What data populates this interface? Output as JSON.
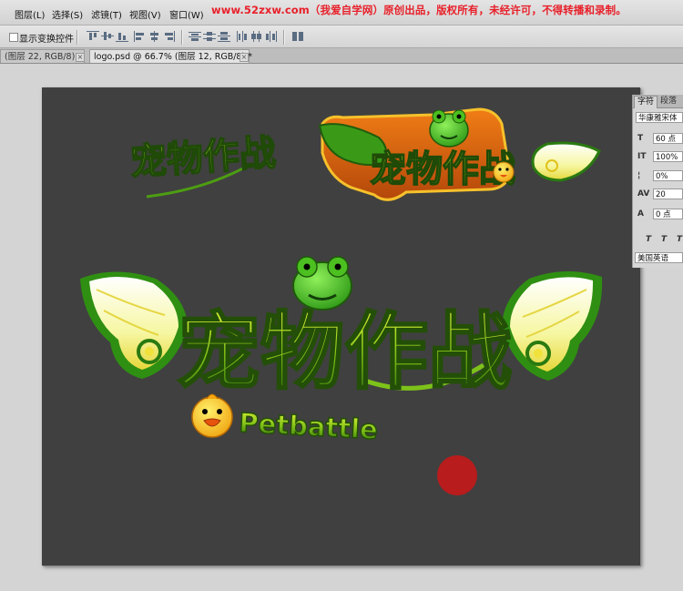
{
  "menu": {
    "items": [
      "图层(L)",
      "选择(S)",
      "滤镜(T)",
      "视图(V)",
      "窗口(W)"
    ]
  },
  "watermark": "www.52zxw.com（我爱自学网）原创出品，版权所有，未经许可，不得转播和录制。",
  "options": {
    "show_transform_label": "显示变换控件",
    "show_transform_checked": false
  },
  "tabs": [
    {
      "label": "(图层 22, RGB/8) *",
      "active": false
    },
    {
      "label": "logo.psd @ 66.7% (图层 12, RGB/8) *",
      "active": true
    }
  ],
  "canvas": {
    "logo_small_text": "宠物作战",
    "logo_badge_text": "宠物作战",
    "logo_large_text": "宠物作战",
    "subtitle": "Petbattle"
  },
  "character_panel": {
    "tab_character": "字符",
    "tab_paragraph": "段落",
    "font_family": "华康雅宋体",
    "font_size": "60 点",
    "vertical_scale": "100%",
    "tracking_pct": "0%",
    "kerning": "20",
    "baseline_shift": "0 点",
    "language": "美国英语",
    "style_labels": [
      "T",
      "T",
      "T"
    ]
  },
  "colors": {
    "canvas_bg": "#404040",
    "watermark_red": "#e8202a",
    "logo_green_dark": "#2f6b0c",
    "logo_yellow": "#d6ef2a",
    "badge_orange": "#d9620b"
  }
}
